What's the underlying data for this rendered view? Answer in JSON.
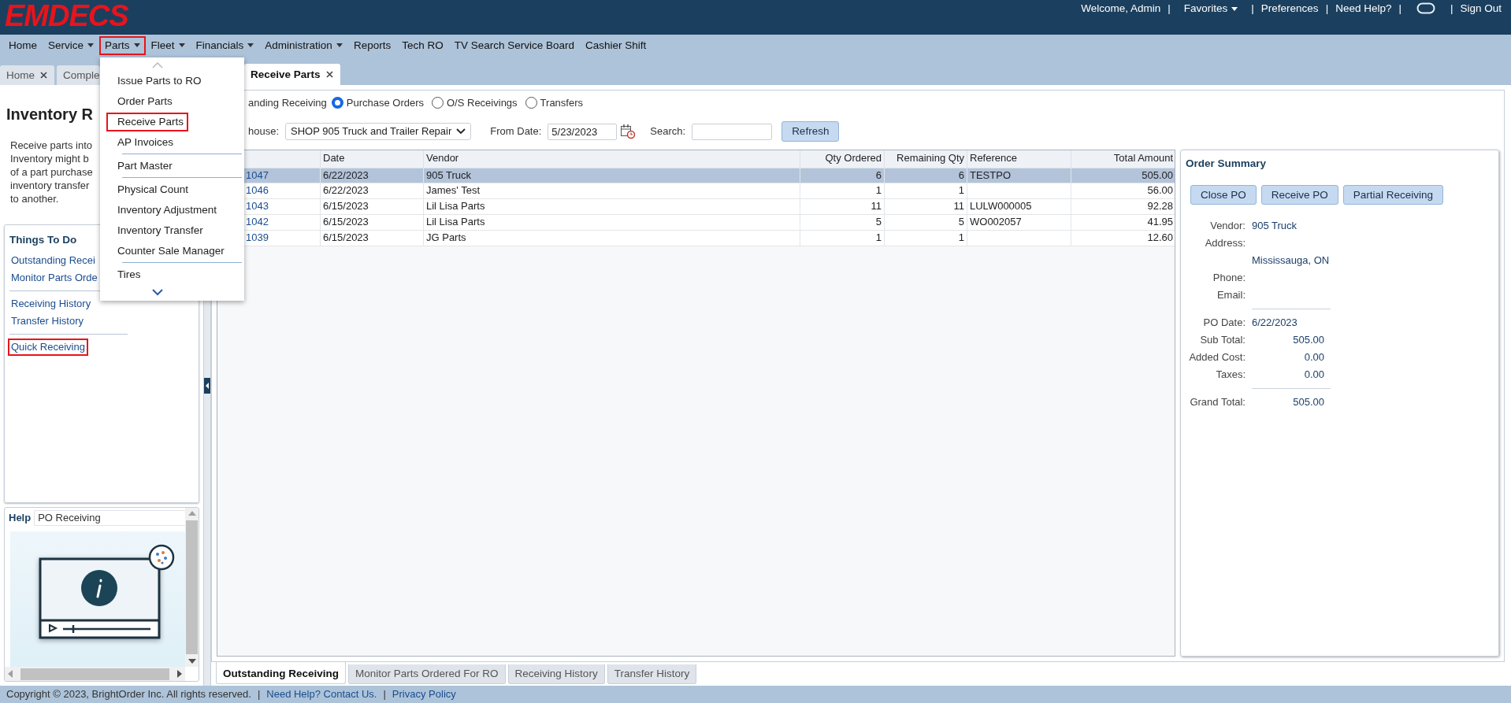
{
  "header": {
    "logo": "EMDECS",
    "items": [
      {
        "kind": "text",
        "label": "Welcome, Admin"
      },
      {
        "kind": "separator",
        "label": "|"
      },
      {
        "kind": "dropdown",
        "label": "Favorites"
      },
      {
        "kind": "separator",
        "label": "|"
      },
      {
        "kind": "link",
        "label": "Preferences"
      },
      {
        "kind": "separator",
        "label": "|"
      },
      {
        "kind": "link",
        "label": "Need Help?"
      },
      {
        "kind": "separator",
        "label": "|"
      },
      {
        "kind": "chat"
      },
      {
        "kind": "separator",
        "label": "|"
      },
      {
        "kind": "link",
        "label": "Sign Out"
      }
    ]
  },
  "nav": [
    {
      "label": "Home",
      "has_menu": false,
      "highlighted": false
    },
    {
      "label": "Service",
      "has_menu": true,
      "highlighted": false
    },
    {
      "label": "Parts",
      "has_menu": true,
      "highlighted": true
    },
    {
      "label": "Fleet",
      "has_menu": true,
      "highlighted": false
    },
    {
      "label": "Financials",
      "has_menu": true,
      "highlighted": false
    },
    {
      "label": "Administration",
      "has_menu": true,
      "highlighted": false
    },
    {
      "label": "Reports",
      "has_menu": false,
      "highlighted": false
    },
    {
      "label": "Tech RO",
      "has_menu": false,
      "highlighted": false
    },
    {
      "label": "TV Search Service Board",
      "has_menu": false,
      "highlighted": false
    },
    {
      "label": "Cashier Shift",
      "has_menu": false,
      "highlighted": false
    }
  ],
  "parts_menu": {
    "groups": [
      [
        {
          "label": "Issue Parts to RO",
          "highlighted": false
        },
        {
          "label": "Order Parts",
          "highlighted": false
        },
        {
          "label": "Receive Parts",
          "highlighted": true
        },
        {
          "label": "AP Invoices",
          "highlighted": false
        }
      ],
      [
        {
          "label": "Part Master",
          "highlighted": false
        }
      ],
      [
        {
          "label": "Physical Count",
          "highlighted": false
        },
        {
          "label": "Inventory Adjustment",
          "highlighted": false
        },
        {
          "label": "Inventory Transfer",
          "highlighted": false
        },
        {
          "label": "Counter Sale Manager",
          "highlighted": false
        }
      ],
      [
        {
          "label": "Tires",
          "highlighted": false
        }
      ]
    ]
  },
  "tabs": [
    {
      "label": "Home",
      "selected": false,
      "close_visible": true
    },
    {
      "label": "Comple",
      "selected": false,
      "close_visible": false
    },
    {
      "label": "Receive Parts",
      "selected": true,
      "close_visible": true
    }
  ],
  "left_panel": {
    "title": "Inventory R",
    "description_lines": [
      "Receive parts into",
      "Inventory might b",
      "of a part purchase",
      "inventory transfer",
      "to another."
    ],
    "things_to_do": {
      "title": "Things To Do",
      "groups": [
        [
          {
            "label": "Outstanding Recei",
            "highlighted": false
          },
          {
            "label": "Monitor Parts Orde",
            "highlighted": false
          }
        ],
        [
          {
            "label": "Receiving History",
            "highlighted": false
          },
          {
            "label": "Transfer History",
            "highlighted": false
          }
        ],
        [
          {
            "label": "Quick Receiving",
            "highlighted": true
          }
        ]
      ]
    },
    "help": {
      "title": "Help",
      "topic": "PO Receiving"
    }
  },
  "filters": {
    "view_label": "anding Receiving",
    "view_options": [
      {
        "label": "Purchase Orders",
        "selected": true
      },
      {
        "label": "O/S Receivings",
        "selected": false
      },
      {
        "label": "Transfers",
        "selected": false
      }
    ],
    "warehouse_label": "house:",
    "warehouse": "SHOP 905 Truck and Trailer Repair",
    "from_date_label": "From Date:",
    "from_date": "5/23/2023",
    "search_label": "Search:",
    "refresh": "Refresh"
  },
  "table": {
    "columns": [
      "Date",
      "Vendor",
      "Qty Ordered",
      "Remaining Qty",
      "Reference",
      "Total Amount"
    ],
    "rows": [
      {
        "po": "1047",
        "date": "6/22/2023",
        "vendor": "905 Truck",
        "qty_ordered": "6",
        "remaining_qty": "6",
        "reference": "TESTPO",
        "total_amount": "505.00",
        "selected": true
      },
      {
        "po": "1046",
        "date": "6/22/2023",
        "vendor": "James' Test",
        "qty_ordered": "1",
        "remaining_qty": "1",
        "total_amount": "56.00",
        "selected": false
      },
      {
        "po": "1043",
        "date": "6/15/2023",
        "vendor": "Lil Lisa Parts",
        "qty_ordered": "11",
        "remaining_qty": "11",
        "reference": "LULW000005",
        "total_amount": "92.28",
        "selected": false
      },
      {
        "po": "1042",
        "date": "6/15/2023",
        "vendor": "Lil Lisa Parts",
        "qty_ordered": "5",
        "remaining_qty": "5",
        "reference": "WO002057",
        "total_amount": "41.95",
        "selected": false
      },
      {
        "po": "1039",
        "date": "6/15/2023",
        "vendor": "JG Parts",
        "qty_ordered": "1",
        "remaining_qty": "1",
        "total_amount": "12.60",
        "selected": false
      }
    ]
  },
  "order_summary": {
    "title": "Order Summary",
    "buttons": [
      "Close PO",
      "Receive PO",
      "Partial Receiving"
    ],
    "groups": [
      [
        {
          "label": "Vendor:",
          "value": "905 Truck",
          "kind": "text"
        },
        {
          "label": "Address:"
        },
        {
          "value": "Mississauga, ON",
          "kind": "text"
        },
        {
          "label": "Phone:"
        },
        {
          "label": "Email:"
        }
      ],
      [
        {
          "label": "PO Date:",
          "value": "6/22/2023",
          "kind": "text"
        },
        {
          "label": "Sub Total:",
          "value": "505.00",
          "kind": "amount"
        },
        {
          "label": "Added Cost:",
          "value": "0.00",
          "kind": "amount"
        },
        {
          "label": "Taxes:",
          "value": "0.00",
          "kind": "amount"
        }
      ],
      [
        {
          "label": "Grand Total:",
          "value": "505.00",
          "kind": "amount"
        }
      ]
    ]
  },
  "bottom_tabs": [
    {
      "label": "Outstanding Receiving",
      "selected": true
    },
    {
      "label": "Monitor Parts Ordered For RO",
      "selected": false
    },
    {
      "label": "Receiving History",
      "selected": false
    },
    {
      "label": "Transfer History",
      "selected": false
    }
  ],
  "footer": [
    {
      "kind": "text",
      "label": "Copyright © 2023, BrightOrder Inc. All rights reserved."
    },
    {
      "kind": "separator",
      "label": "|"
    },
    {
      "kind": "link",
      "label": "Need Help? Contact Us."
    },
    {
      "kind": "separator",
      "label": "|"
    },
    {
      "kind": "link",
      "label": "Privacy Policy"
    }
  ]
}
